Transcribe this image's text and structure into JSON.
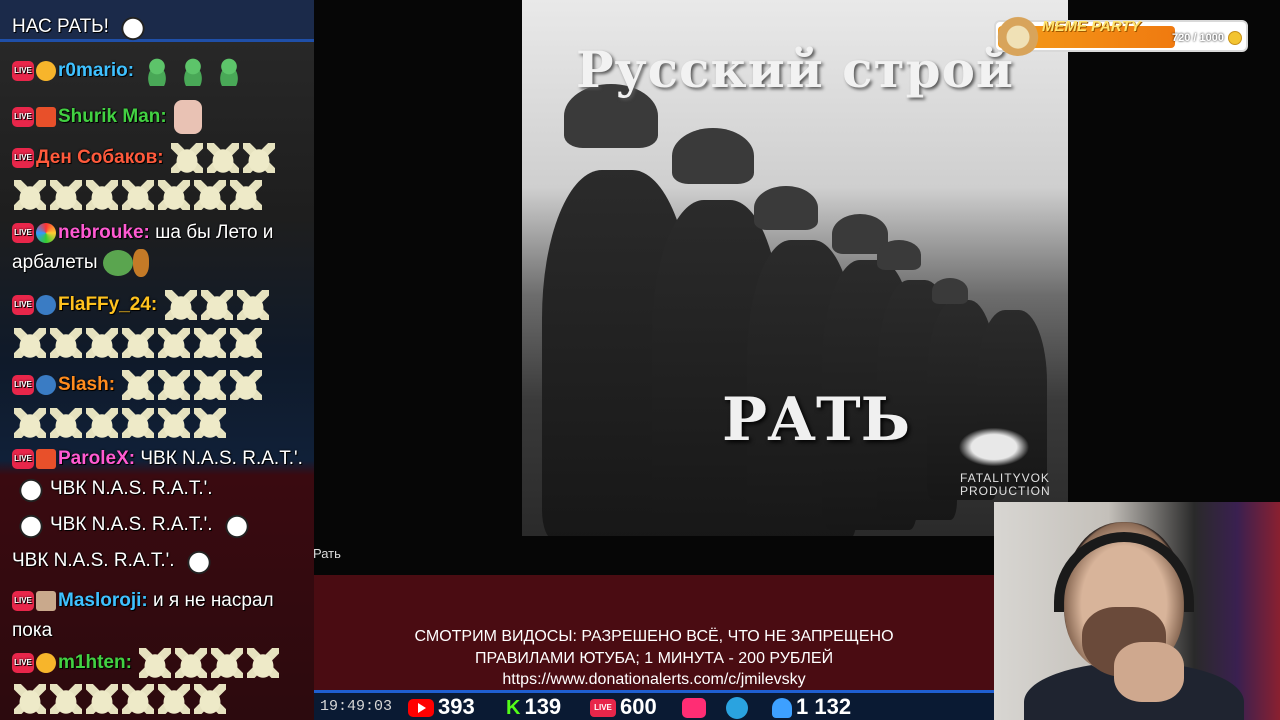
{
  "chat": {
    "header_text": "НАС РАТЬ!",
    "messages": [
      {
        "nick": "r0mario:",
        "nick_color": "#3fc1ff",
        "text": ""
      },
      {
        "nick": "Shurik Man:",
        "nick_color": "#42d142",
        "text": ""
      },
      {
        "nick": "Ден Собаков:",
        "nick_color": "#ff5a3c",
        "text": ""
      },
      {
        "nick": "nebrouke:",
        "nick_color": "#ff5ad2",
        "text": "ша бы Лето и арбалеты"
      },
      {
        "nick": "FlaFFy_24:",
        "nick_color": "#ffc21e",
        "text": ""
      },
      {
        "nick": "Slash:",
        "nick_color": "#ff8c1e",
        "text": ""
      },
      {
        "nick": "ParoleX:",
        "nick_color": "#ff5ad2",
        "text": "ЧВК N.A.S. R.A.T.'.",
        "text2": "ЧВК N.A.S. R.A.T.'.",
        "text3": "ЧВК N.A.S. R.A.T.'.",
        "text4": "ЧВК N.A.S. R.A.T.'."
      },
      {
        "nick": "Masloroji:",
        "nick_color": "#3fc1ff",
        "text": "и я не насрал пока"
      },
      {
        "nick": "m1hten:",
        "nick_color": "#42d142",
        "text": ""
      }
    ]
  },
  "video": {
    "title": "Русский строй",
    "subtitle": "РАТЬ",
    "producer": "FATALITYVOK PRODUCTION",
    "label": "Рать"
  },
  "meme_party": {
    "label": "MEME PARTY",
    "count": "720 / 1000",
    "progress": 0.72
  },
  "banner": {
    "line1": "СМОТРИМ ВИДОСЫ: РАЗРЕШЕНО ВСЁ, ЧТО НЕ ЗАПРЕЩЕНО",
    "line2": "ПРАВИЛАМИ ЮТУБА; 1 МИНУТА - 200 РУБЛЕЙ",
    "url": "https://www.donationalerts.com/c/jmilevsky"
  },
  "status": {
    "clock": "19:49:03",
    "youtube": "393",
    "kick": "139",
    "live": "600",
    "telegram_label": "",
    "viewers": "1 132"
  },
  "icons": {
    "youtube": "youtube-icon",
    "kick": "kick-icon",
    "live": "live-icon",
    "vkplay": "vk-play-icon",
    "telegram": "telegram-icon",
    "user": "user-icon"
  }
}
